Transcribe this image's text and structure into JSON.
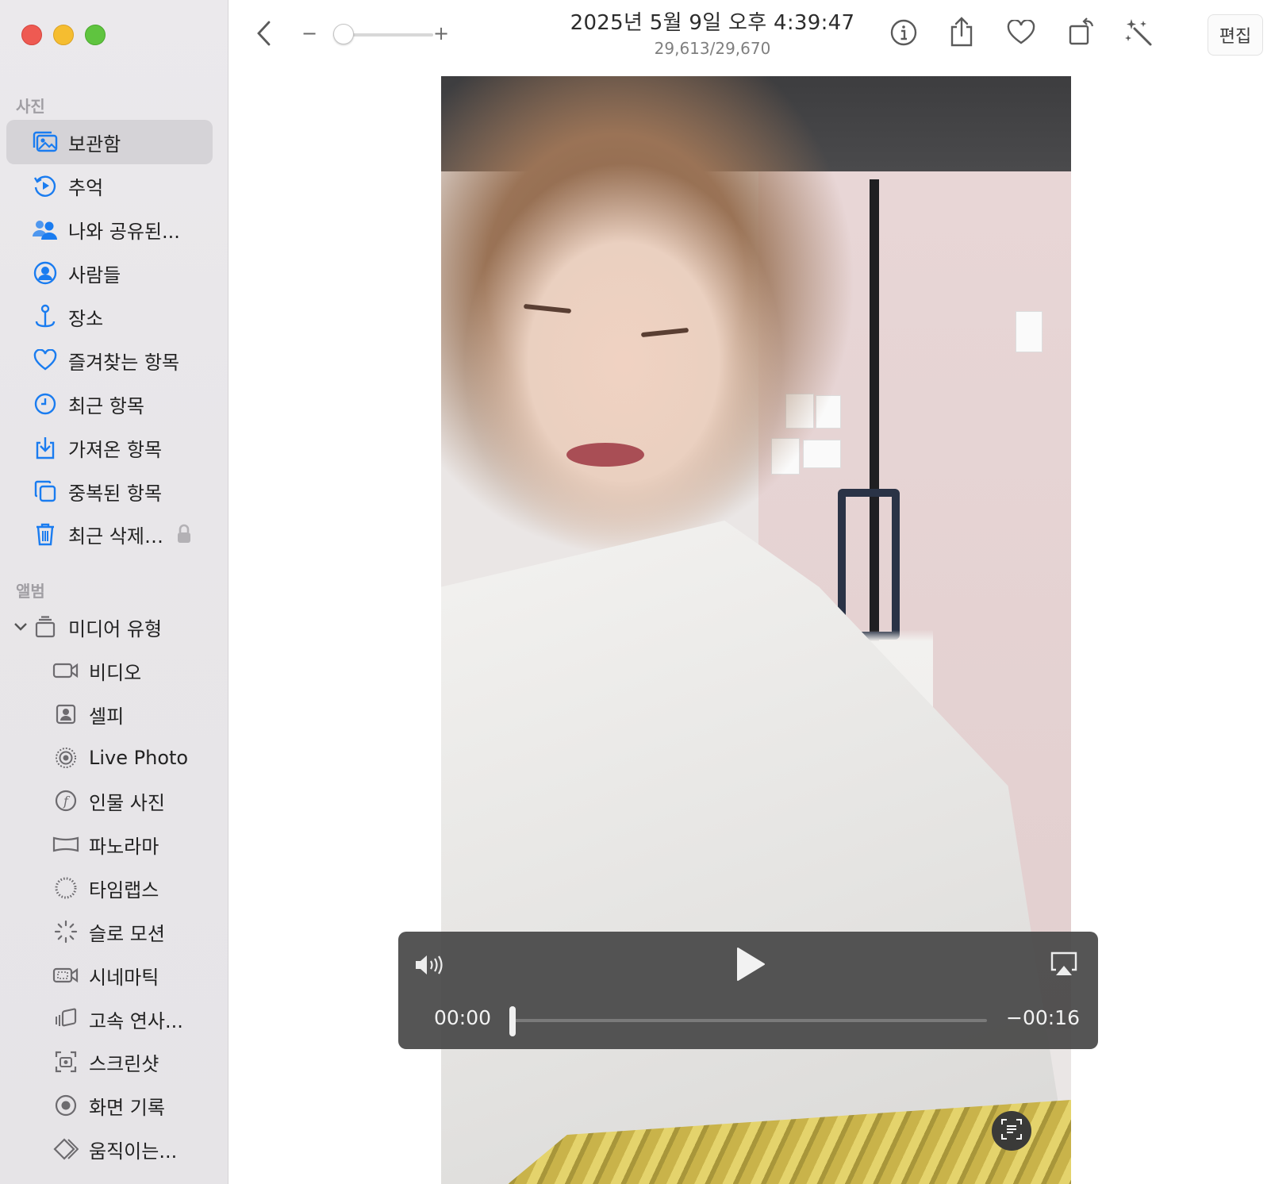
{
  "window": {
    "title": "2025년 5월 9일 오후 4:39:47",
    "counter": "29,613/29,670",
    "edit_label": "편집"
  },
  "toolbar": {
    "zoom_minus": "−",
    "zoom_plus": "+"
  },
  "sidebar": {
    "section_photos": "사진",
    "section_albums": "앨범",
    "items": [
      {
        "label": "보관함",
        "icon": "library-icon",
        "selected": true
      },
      {
        "label": "추억",
        "icon": "memories-icon"
      },
      {
        "label": "나와 공유된...",
        "icon": "shared-with-you-icon"
      },
      {
        "label": "사람들",
        "icon": "people-icon"
      },
      {
        "label": "장소",
        "icon": "places-icon"
      },
      {
        "label": "즐겨찾는 항목",
        "icon": "heart-icon"
      },
      {
        "label": "최근 항목",
        "icon": "clock-icon"
      },
      {
        "label": "가져온 항목",
        "icon": "import-icon"
      },
      {
        "label": "중복된 항목",
        "icon": "duplicates-icon"
      },
      {
        "label": "최근 삭제…",
        "icon": "trash-icon",
        "locked": true
      }
    ],
    "media_types": {
      "label": "미디어 유형",
      "items": [
        {
          "label": "비디오",
          "icon": "video-icon"
        },
        {
          "label": "셀피",
          "icon": "selfie-icon"
        },
        {
          "label": "Live Photo",
          "icon": "live-photo-icon"
        },
        {
          "label": "인물 사진",
          "icon": "portrait-icon"
        },
        {
          "label": "파노라마",
          "icon": "panorama-icon"
        },
        {
          "label": "타임랩스",
          "icon": "timelapse-icon"
        },
        {
          "label": "슬로 모션",
          "icon": "slow-motion-icon"
        },
        {
          "label": "시네마틱",
          "icon": "cinematic-icon"
        },
        {
          "label": "고속 연사...",
          "icon": "burst-icon"
        },
        {
          "label": "스크린샷",
          "icon": "screenshot-icon"
        },
        {
          "label": "화면 기록",
          "icon": "screen-recording-icon"
        },
        {
          "label": "움직이는...",
          "icon": "animated-icon"
        }
      ]
    }
  },
  "player": {
    "elapsed": "00:00",
    "remaining": "−00:16",
    "progress": 0
  },
  "colors": {
    "accent": "#1a7cf0",
    "sidebar_bg": "#e9e7ea",
    "selected_bg": "#d5d3d7"
  }
}
